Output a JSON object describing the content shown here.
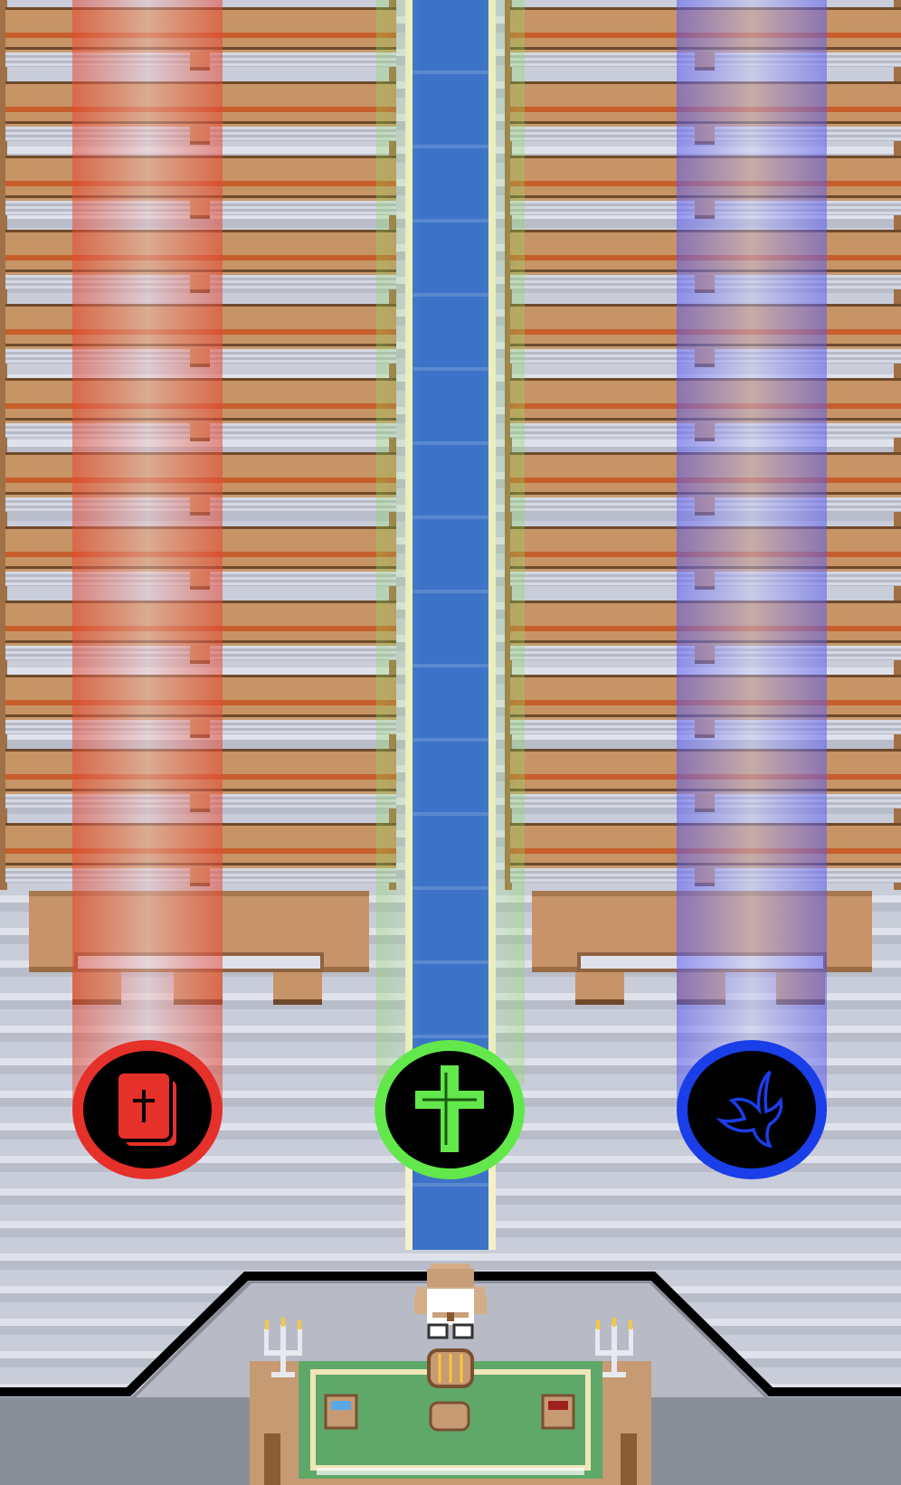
{
  "scene": {
    "location": "church nave",
    "pew_rows": 12,
    "colors": {
      "carpet": "#3c73c8",
      "pew_wood": "#c79466",
      "pew_stripe": "#c65e2c",
      "floor": "#c9cdd9",
      "altar_cloth": "#5fa86a"
    }
  },
  "actions": [
    {
      "id": "bible",
      "icon": "bible-icon",
      "color": "#e6302a"
    },
    {
      "id": "cross",
      "icon": "cross-icon",
      "color": "#62e84a"
    },
    {
      "id": "dove",
      "icon": "dove-icon",
      "color": "#1a3ee8"
    }
  ],
  "characters": [
    {
      "id": "priest",
      "icon": "priest-sprite"
    }
  ]
}
